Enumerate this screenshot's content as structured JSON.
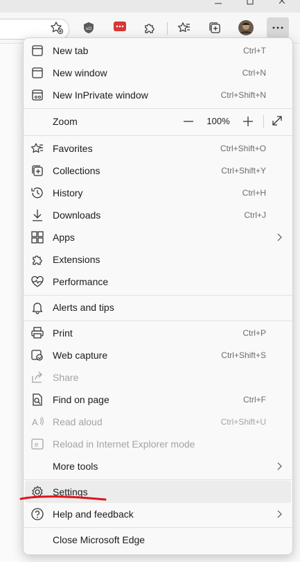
{
  "menu": {
    "zoom": {
      "label": "Zoom",
      "value": "100%"
    },
    "items": {
      "new_tab": {
        "label": "New tab",
        "shortcut": "Ctrl+T"
      },
      "new_window": {
        "label": "New window",
        "shortcut": "Ctrl+N"
      },
      "new_inprivate": {
        "label": "New InPrivate window",
        "shortcut": "Ctrl+Shift+N"
      },
      "favorites": {
        "label": "Favorites",
        "shortcut": "Ctrl+Shift+O"
      },
      "collections": {
        "label": "Collections",
        "shortcut": "Ctrl+Shift+Y"
      },
      "history": {
        "label": "History",
        "shortcut": "Ctrl+H"
      },
      "downloads": {
        "label": "Downloads",
        "shortcut": "Ctrl+J"
      },
      "apps": {
        "label": "Apps"
      },
      "extensions": {
        "label": "Extensions"
      },
      "performance": {
        "label": "Performance"
      },
      "alerts": {
        "label": "Alerts and tips"
      },
      "print": {
        "label": "Print",
        "shortcut": "Ctrl+P"
      },
      "web_capture": {
        "label": "Web capture",
        "shortcut": "Ctrl+Shift+S"
      },
      "share": {
        "label": "Share"
      },
      "find": {
        "label": "Find on page",
        "shortcut": "Ctrl+F"
      },
      "read_aloud": {
        "label": "Read aloud",
        "shortcut": "Ctrl+Shift+U"
      },
      "reload_ie": {
        "label": "Reload in Internet Explorer mode"
      },
      "more_tools": {
        "label": "More tools"
      },
      "settings": {
        "label": "Settings"
      },
      "help": {
        "label": "Help and feedback"
      },
      "close": {
        "label": "Close Microsoft Edge"
      }
    }
  },
  "toolbar": {
    "extension_badge": "2"
  },
  "colors": {
    "annotation_red": "#e0131b",
    "extension_red": "#d93636",
    "ublock": "#5b5b5b"
  }
}
